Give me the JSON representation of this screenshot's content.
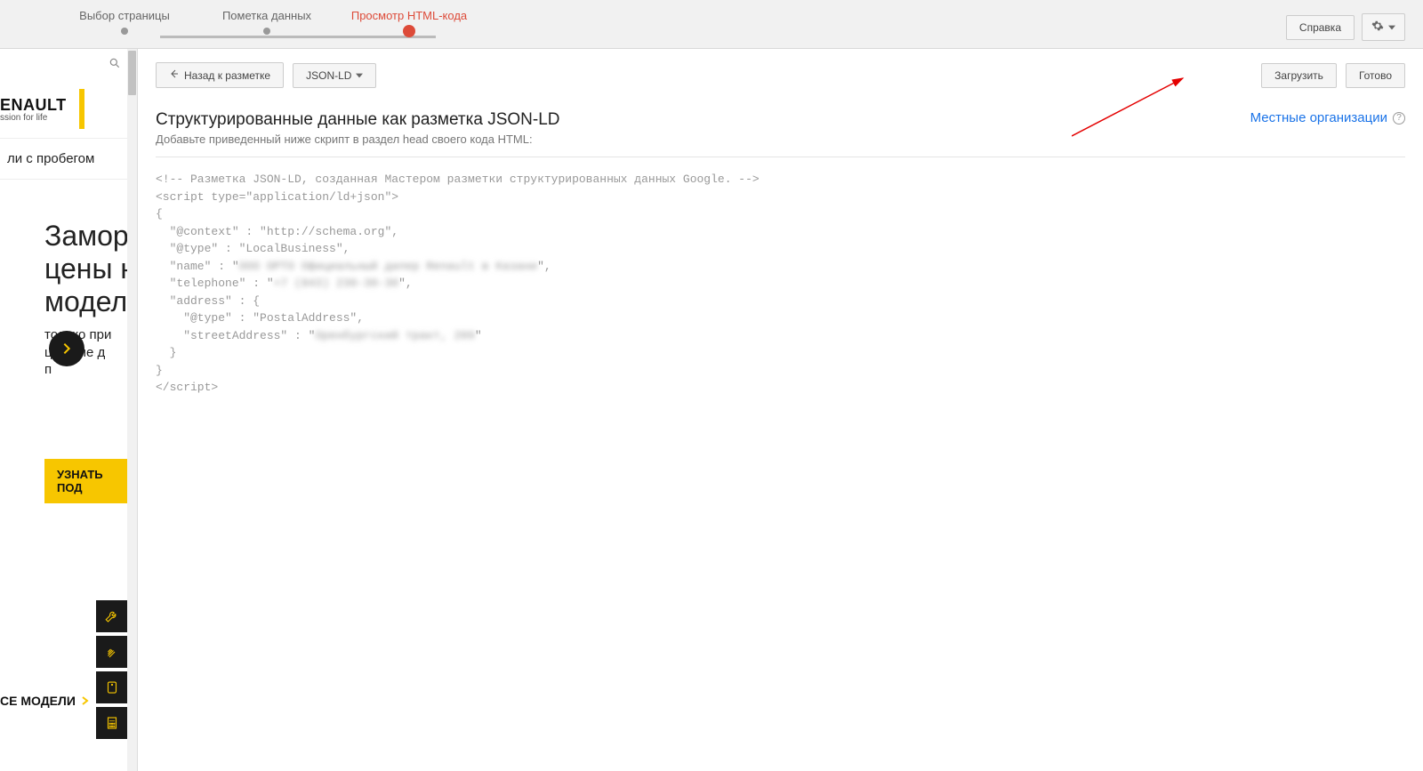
{
  "stepper": {
    "steps": [
      {
        "label": "Выбор страницы"
      },
      {
        "label": "Пометка данных"
      },
      {
        "label": "Просмотр HTML-кода"
      }
    ],
    "active_index": 2
  },
  "top_actions": {
    "help_label": "Справка"
  },
  "toolbar": {
    "back_label": "Назад к разметке",
    "format_label": "JSON-LD",
    "download_label": "Загрузить",
    "done_label": "Готово"
  },
  "section": {
    "title": "Структурированные данные как разметка JSON-LD",
    "subtitle": "Добавьте приведенный ниже скрипт в раздел head своего кода HTML:",
    "link_label": "Местные организации"
  },
  "code": {
    "l1": "<!-- Разметка JSON-LD, созданная Мастером разметки структурированных данных Google. -->",
    "l2": "<script type=\"application/ld+json\">",
    "l3": "{",
    "l4": "  \"@context\" : \"http://schema.org\",",
    "l5": "  \"@type\" : \"LocalBusiness\",",
    "l6a": "  \"name\" : \"",
    "l6b": "ООО ОРТО Официальный дилер Renault в Казани",
    "l6c": "\",",
    "l7a": "  \"telephone\" : \"",
    "l7b": "+7 (843) 230-30-30",
    "l7c": "\",",
    "l8": "  \"address\" : {",
    "l9": "    \"@type\" : \"PostalAddress\",",
    "l10a": "    \"streetAddress\" : \"",
    "l10b": "Оренбургский тракт, 209",
    "l10c": "\"",
    "l11": "  }",
    "l12": "}",
    "l13": "</script>"
  },
  "preview": {
    "brand": "ENAULT",
    "brand_sub": "ssion for life",
    "nav_item": "ли с пробегом",
    "hero_line1": "Замор",
    "hero_line2": "цены н",
    "hero_line3": "модел",
    "hero_sub1": "только при",
    "hero_sub2": "ци  руме д",
    "hero_sub3": "п",
    "cta": "УЗНАТЬ ПОД",
    "all_models": "СЕ МОДЕЛИ"
  }
}
